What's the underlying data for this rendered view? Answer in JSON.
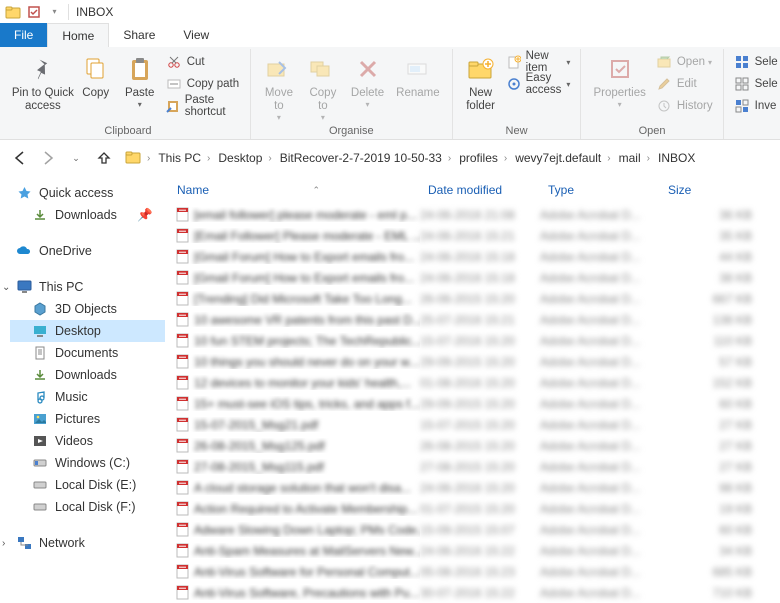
{
  "title": "INBOX",
  "tabs": {
    "file": "File",
    "home": "Home",
    "share": "Share",
    "view": "View"
  },
  "ribbon": {
    "clipboard": {
      "label": "Clipboard",
      "pin": "Pin to Quick\naccess",
      "copy": "Copy",
      "paste": "Paste",
      "cut": "Cut",
      "copypath": "Copy path",
      "pasteshortcut": "Paste shortcut"
    },
    "organise": {
      "label": "Organise",
      "moveto": "Move\nto",
      "copyto": "Copy\nto",
      "delete": "Delete",
      "rename": "Rename"
    },
    "new": {
      "label": "New",
      "newfolder": "New\nfolder",
      "newitem": "New item",
      "easyaccess": "Easy access"
    },
    "open": {
      "label": "Open",
      "properties": "Properties",
      "open": "Open",
      "edit": "Edit",
      "history": "History"
    },
    "select": {
      "all": "Sele",
      "none": "Sele",
      "invert": "Inve"
    }
  },
  "breadcrumb": [
    "This PC",
    "Desktop",
    "BitRecover-2-7-2019 10-50-33",
    "profiles",
    "wevy7ejt.default",
    "mail",
    "INBOX"
  ],
  "sidebar": {
    "quick": {
      "label": "Quick access",
      "downloads": "Downloads"
    },
    "onedrive": "OneDrive",
    "thispc": {
      "label": "This PC",
      "items": [
        "3D Objects",
        "Desktop",
        "Documents",
        "Downloads",
        "Music",
        "Pictures",
        "Videos",
        "Windows (C:)",
        "Local Disk (E:)",
        "Local Disk (F:)"
      ]
    },
    "network": "Network"
  },
  "columns": {
    "name": "Name",
    "date": "Date modified",
    "type": "Type",
    "size": "Size"
  },
  "files": [
    {
      "name": "[email follower] please moderate - eml p...",
      "date": "24-06-2016 21:08",
      "type": "Adobe Acrobat D...",
      "size": "36 KB"
    },
    {
      "name": "[Email Follower] Please moderate - EML ...",
      "date": "24-06-2016 15:21",
      "type": "Adobe Acrobat D...",
      "size": "35 KB"
    },
    {
      "name": "[Gmail Forum] How to Export emails fro...",
      "date": "24-06-2016 15:18",
      "type": "Adobe Acrobat D...",
      "size": "44 KB"
    },
    {
      "name": "[Gmail Forum] How to Export emails fro...",
      "date": "24-06-2016 15:18",
      "type": "Adobe Acrobat D...",
      "size": "38 KB"
    },
    {
      "name": "[Trending] Did Microsoft Take Too Long...",
      "date": "26-06-2015 15:20",
      "type": "Adobe Acrobat D...",
      "size": "667 KB"
    },
    {
      "name": "10 awesome VR patents from this past D...",
      "date": "25-07-2016 15:21",
      "type": "Adobe Acrobat D...",
      "size": "138 KB"
    },
    {
      "name": "10 fun STEM projects; The TechRepublic...",
      "date": "15-07-2016 15:20",
      "type": "Adobe Acrobat D...",
      "size": "110 KB"
    },
    {
      "name": "10 things you should never do on your w...",
      "date": "29-09-2015 15:20",
      "type": "Adobe Acrobat D...",
      "size": "57 KB"
    },
    {
      "name": "12 devices to monitor your kids' health,...",
      "date": "01-08-2016 15:20",
      "type": "Adobe Acrobat D...",
      "size": "152 KB"
    },
    {
      "name": "15+ must-see iOS tips, tricks, and apps f...",
      "date": "29-09-2015 15:20",
      "type": "Adobe Acrobat D...",
      "size": "60 KB"
    },
    {
      "name": "15-07-2015_Msg21.pdf",
      "date": "15-07-2015 15:20",
      "type": "Adobe Acrobat D...",
      "size": "27 KB"
    },
    {
      "name": "26-08-2015_Msg125.pdf",
      "date": "26-08-2015 15:20",
      "type": "Adobe Acrobat D...",
      "size": "27 KB"
    },
    {
      "name": "27-08-2015_Msg115.pdf",
      "date": "27-08-2015 15:20",
      "type": "Adobe Acrobat D...",
      "size": "27 KB"
    },
    {
      "name": "A cloud storage solution that won't disa...",
      "date": "24-06-2016 15:20",
      "type": "Adobe Acrobat D...",
      "size": "98 KB"
    },
    {
      "name": "Action Required to Activate Membership...",
      "date": "01-07-2015 15:20",
      "type": "Adobe Acrobat D...",
      "size": "19 KB"
    },
    {
      "name": "Adware Slowing Down Laptop; PMs Code...",
      "date": "15-09-2015 15:07",
      "type": "Adobe Acrobat D...",
      "size": "60 KB"
    },
    {
      "name": "Anti-Spam Measures at MailServers New...",
      "date": "24-06-2016 15:22",
      "type": "Adobe Acrobat D...",
      "size": "34 KB"
    },
    {
      "name": "Anti-Virus Software for Personal Comput...",
      "date": "05-08-2016 15:23",
      "type": "Adobe Acrobat D...",
      "size": "685 KB"
    },
    {
      "name": "Anti-Virus Software, Precautions with Pu...",
      "date": "30-07-2016 15:22",
      "type": "Adobe Acrobat D...",
      "size": "710 KB"
    }
  ]
}
